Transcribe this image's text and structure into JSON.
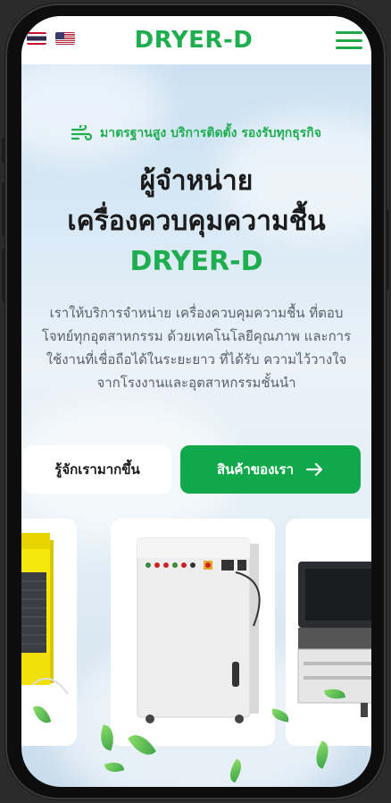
{
  "header": {
    "brand": "DRYER-D",
    "language_flags": [
      "thai-flag",
      "us-flag"
    ],
    "menu_icon": "hamburger-menu-icon"
  },
  "hero": {
    "tagline": "มาตรฐานสูง บริการติดตั้ง รองรับทุกธุรกิจ",
    "title_line1": "ผู้จำหน่าย",
    "title_line2": "เครื่องควบคุมความชื้น",
    "title_brand": "DRYER-D",
    "description": "เราให้บริการจำหน่าย เครื่องควบคุมความชื้น ที่ตอบโจทย์ทุกอุตสาหกรรม ด้วยเทคโนโลยีคุณภาพ และการใช้งานที่เชื่อถือได้ในระยะยาว ที่ได้รับ ความไว้วางใจจากโรงงานและอุตสาหกรรมชั้นนำ"
  },
  "buttons": {
    "about_label": "รู้จักเรามากขึ้น",
    "products_label": "สินค้าของเรา"
  },
  "products": [
    {
      "name": "yellow-dehumidifier-image"
    },
    {
      "name": "white-industrial-dehumidifier-image"
    },
    {
      "name": "black-dehumidifier-image"
    }
  ],
  "colors": {
    "brand_green": "#1fae4f",
    "button_green": "#11a84b",
    "text_dark": "#1b1b1b",
    "text_muted": "#5a5f66"
  }
}
